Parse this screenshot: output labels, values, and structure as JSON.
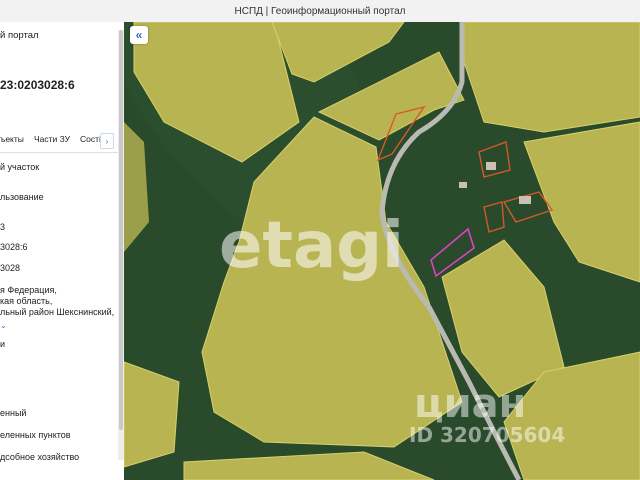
{
  "window": {
    "title": "НСПД | Геоинформационный портал"
  },
  "panel": {
    "portal_label": "й портал",
    "cadastral_number": "23:0203028:6",
    "tabs": [
      {
        "label": "ъекты"
      },
      {
        "label": "Части ЗУ"
      },
      {
        "label": "Сості"
      }
    ],
    "tab_next_glyph": "›",
    "lines": [
      "й участок",
      "льзование",
      "3",
      "3028:6",
      "3028",
      "я Федерация,",
      "кая область,",
      "льный район Шекснинский,",
      "и",
      "енный",
      "еленных пунктов",
      "дсобное хозяйство"
    ],
    "expand_glyph": "⌄"
  },
  "map": {
    "collapse_glyph": "«",
    "watermarks": {
      "etagi": "etagi",
      "cian": "циан",
      "cian_id": "ID 320705604"
    }
  },
  "colors": {
    "field": "#b9b452",
    "forest": "#294a2b",
    "parcel_outline": "#d6d16a",
    "building_outline": "#d25a2a",
    "selected_parcel": "#e040c8",
    "road": "#b9bbb3",
    "accent": "#2a6ad6"
  }
}
